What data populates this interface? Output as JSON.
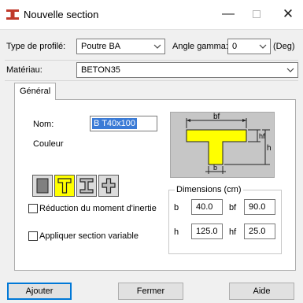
{
  "window": {
    "title": "Nouvelle section",
    "minimize_glyph": "—",
    "close_glyph": "✕"
  },
  "profile": {
    "type_label": "Type de profilé:",
    "type_value": "Poutre BA",
    "gamma_label": "Angle gamma:",
    "gamma_value": "0",
    "gamma_unit": "(Deg)"
  },
  "material": {
    "label": "Matériau:",
    "value": "BETON35"
  },
  "tabs": [
    {
      "label": "Général",
      "selected": true
    }
  ],
  "general": {
    "name_label": "Nom:",
    "name_value": "B T40x100",
    "color_label": "Couleur",
    "shape_buttons": [
      {
        "name": "rectangle",
        "active": false
      },
      {
        "name": "tee",
        "active": true
      },
      {
        "name": "i-beam",
        "active": false
      },
      {
        "name": "cross",
        "active": false
      }
    ],
    "reduce_inertia_label": "Réduction du moment d'inertie",
    "reduce_inertia_checked": false,
    "variable_section_label": "Appliquer section variable",
    "variable_section_checked": false
  },
  "preview": {
    "label_bf": "bf",
    "label_hf": "hf",
    "label_h": "h",
    "label_b": "b",
    "section_color": "#ffff00"
  },
  "dimensions": {
    "title": "Dimensions (cm)",
    "b_label": "b",
    "b_value": "40.0",
    "bf_label": "bf",
    "bf_value": "90.0",
    "h_label": "h",
    "h_value": "125.0",
    "hf_label": "hf",
    "hf_value": "25.0"
  },
  "buttons": {
    "add": "Ajouter",
    "close": "Fermer",
    "help": "Aide"
  },
  "colors": {
    "accent": "#0078d7",
    "selection": "#3b7bd6",
    "icon_red": "#c0392b"
  }
}
